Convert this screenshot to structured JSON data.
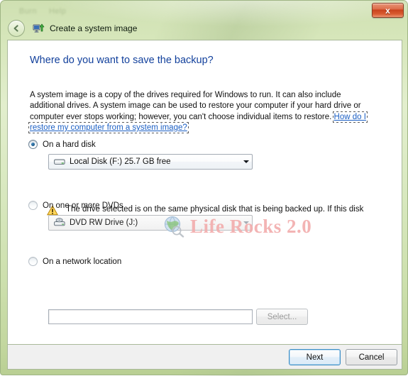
{
  "window": {
    "title": "Create a system image",
    "app_icon": "system-image-monitor-icon",
    "back_button": "back-arrow-icon",
    "close_label": "x",
    "ghost_toolbar": [
      "Burn",
      "Help"
    ]
  },
  "page": {
    "heading": "Where do you want to save the backup?",
    "paragraph_before_link": "A system image is a copy of the drives required for Windows to run. It can also include additional drives. A system image can be used to restore your computer if your hard drive or computer ever stops working; however, you can't choose individual items to restore. ",
    "help_link": "How do I restore my computer from a system image?"
  },
  "options": {
    "hard_disk": {
      "label": "On a hard disk",
      "selected": true,
      "combo_value": "Local Disk (F:)  25.7 GB free",
      "combo_icon": "hard-drive-icon",
      "enabled": true
    },
    "dvds": {
      "label": "On one or more DVDs",
      "selected": false,
      "combo_value": "DVD RW Drive (J:)",
      "combo_icon": "dvd-drive-icon",
      "enabled": false
    },
    "network": {
      "label": "On a network location",
      "selected": false,
      "field_value": "",
      "field_placeholder": "",
      "select_button": "Select..."
    }
  },
  "warning": {
    "icon": "warning-triangle-icon",
    "text": "The drive selected is on the same physical disk that is being backed up. If this disk fails, you will lose your backups."
  },
  "watermark": {
    "text": "Life Rocks 2.0",
    "icon": "globe-search-icon",
    "color": "#f2aeae"
  },
  "footer": {
    "next_label": "Next",
    "cancel_label": "Cancel"
  },
  "colors": {
    "frame_glass": "#d8e8bf",
    "heading_blue": "#12409c",
    "link_blue": "#1b5fc4",
    "close_red": "#c9421d",
    "default_button_border": "#3c8dc5"
  }
}
